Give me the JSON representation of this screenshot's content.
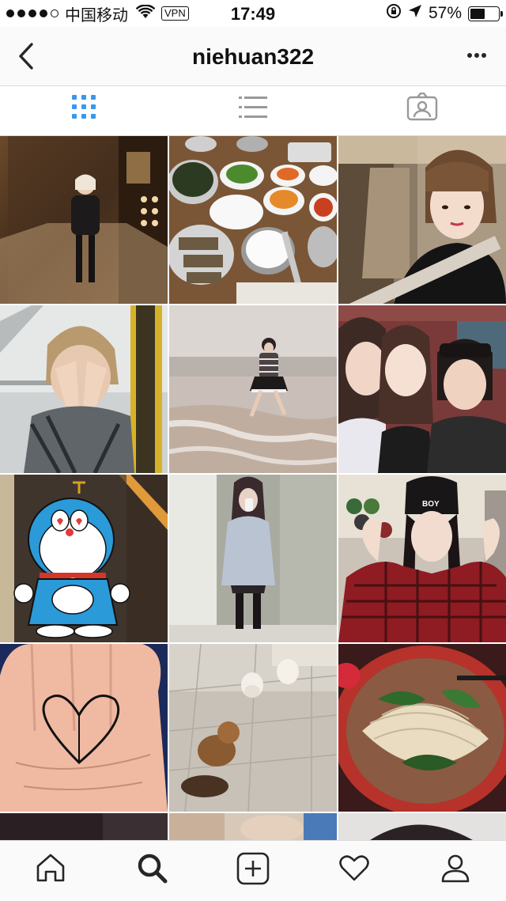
{
  "status_bar": {
    "carrier": "中国移动",
    "vpn": "VPN",
    "time": "17:49",
    "battery": "57%",
    "battery_level": 0.57
  },
  "header": {
    "username": "niehuan322",
    "back_icon": "chevron-left-icon",
    "more_icon": "ellipsis-icon"
  },
  "view_tabs": [
    {
      "name": "grid-view",
      "icon": "grid-icon",
      "active": true
    },
    {
      "name": "list-view",
      "icon": "list-icon",
      "active": false
    },
    {
      "name": "tagged-view",
      "icon": "tagged-person-icon",
      "active": false
    }
  ],
  "posts": [
    {
      "subject": "elevator mirror selfie"
    },
    {
      "subject": "korean barbecue table"
    },
    {
      "subject": "car selfie"
    },
    {
      "subject": "girl covering face"
    },
    {
      "subject": "girl on beach"
    },
    {
      "subject": "three friends selfie"
    },
    {
      "subject": "doraemon sticker"
    },
    {
      "subject": "mirror selfie in coat"
    },
    {
      "subject": "girl in beanie"
    },
    {
      "subject": "heart string on palm"
    },
    {
      "subject": "puppies on floor"
    },
    {
      "subject": "noodle soup bowl"
    }
  ],
  "tab_bar": [
    {
      "name": "home",
      "icon": "home-icon",
      "active": false
    },
    {
      "name": "search",
      "icon": "search-icon",
      "active": true
    },
    {
      "name": "add",
      "icon": "add-post-icon",
      "active": false
    },
    {
      "name": "activity",
      "icon": "heart-icon",
      "active": false
    },
    {
      "name": "profile",
      "icon": "profile-icon",
      "active": false
    }
  ],
  "colors": {
    "accent": "#3897f0",
    "icon_inactive": "#999999",
    "icon_active": "#262626",
    "divider": "#dbdbdb"
  }
}
